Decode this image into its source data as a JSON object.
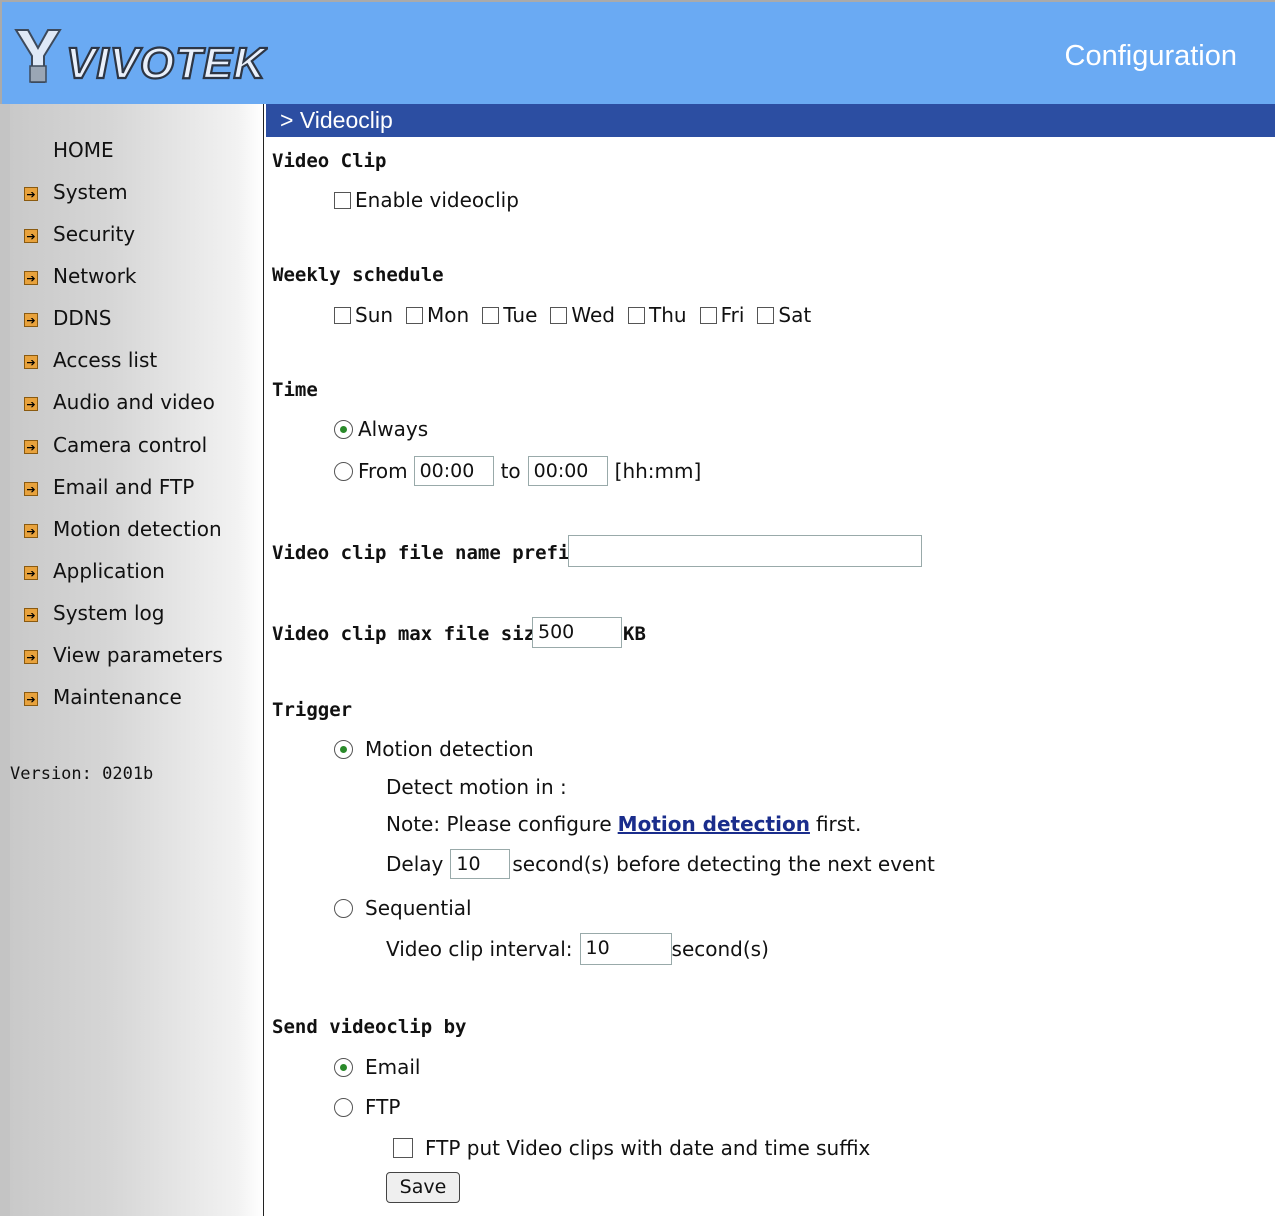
{
  "header": {
    "logo_text": "VIVOTEK",
    "title": "Configuration"
  },
  "sidebar": {
    "home": "HOME",
    "items": [
      "System",
      "Security",
      "Network",
      "DDNS",
      "Access list",
      "Audio and video",
      "Camera control",
      "Email and FTP",
      "Motion detection",
      "Application",
      "System log",
      "View parameters",
      "Maintenance"
    ],
    "version": "Version: 0201b"
  },
  "page": {
    "breadcrumb": "> Videoclip"
  },
  "video_clip": {
    "heading": "Video Clip",
    "enable_label": "Enable videoclip",
    "enabled": false
  },
  "weekly": {
    "heading": "Weekly schedule",
    "days": [
      "Sun",
      "Mon",
      "Tue",
      "Wed",
      "Thu",
      "Fri",
      "Sat"
    ]
  },
  "time": {
    "heading": "Time",
    "always_label": "Always",
    "from_label": "From",
    "from_value": "00:00",
    "to_label": "to",
    "to_value": "00:00",
    "format_hint": "[hh:mm]",
    "selected": "Always"
  },
  "prefix": {
    "label": "Video clip file name prefix",
    "value": ""
  },
  "max_size": {
    "label": "Video clip max file size",
    "value": "500",
    "unit": "KB"
  },
  "trigger": {
    "heading": "Trigger",
    "motion_label": "Motion detection",
    "detect_label": "Detect motion in :",
    "note_prefix": "Note: Please configure",
    "note_link": "Motion detection",
    "note_suffix": "first.",
    "delay_label": "Delay",
    "delay_value": "10",
    "delay_suffix": "second(s) before detecting the next event",
    "sequential_label": "Sequential",
    "interval_label": "Video clip interval:",
    "interval_value": "10",
    "interval_suffix": "second(s)",
    "selected": "Motion detection"
  },
  "send": {
    "heading": "Send videoclip by",
    "email_label": "Email",
    "ftp_label": "FTP",
    "ftp_suffix_label": "FTP put Video clips with date and time suffix",
    "selected": "Email"
  },
  "save_label": "Save"
}
